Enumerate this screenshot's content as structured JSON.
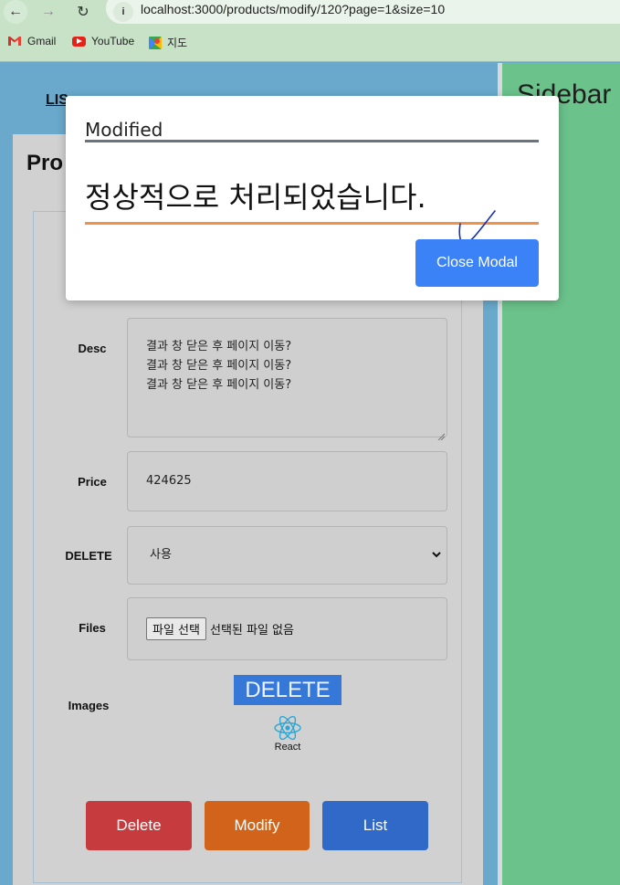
{
  "browser": {
    "url": "localhost:3000/products/modify/120?page=1&size=10",
    "bookmarks": [
      {
        "label": "Gmail",
        "icon": "gmail-icon"
      },
      {
        "label": "YouTube",
        "icon": "youtube-icon"
      },
      {
        "label": "지도",
        "icon": "maps-icon"
      }
    ]
  },
  "nav": {
    "list_link": "LIS"
  },
  "sidebar": {
    "title": "Sidebar"
  },
  "content": {
    "title": "Pro",
    "fields": {
      "desc": {
        "label": "Desc",
        "lines": [
          "결과 창 닫은 후 페이지 이동?",
          "결과 창 닫은 후 페이지 이동?",
          "결과 창 닫은 후 페이지 이동?"
        ]
      },
      "price": {
        "label": "Price",
        "value": "424625"
      },
      "delete": {
        "label": "DELETE",
        "selected": "사용"
      },
      "files": {
        "label": "Files",
        "button": "파일 선택",
        "status": "선택된 파일 없음"
      },
      "images": {
        "label": "Images",
        "delete_label": "DELETE",
        "image_caption": "React"
      }
    },
    "buttons": {
      "delete": "Delete",
      "modify": "Modify",
      "list": "List"
    }
  },
  "modal": {
    "title": "Modified",
    "message": "정상적으로 처리되었습니다.",
    "close_label": "Close Modal"
  },
  "colors": {
    "main_bg": "#6aa9cc",
    "sidebar_bg": "#6bc28b",
    "delete_btn": "#c63b3d",
    "modify_btn": "#d1641a",
    "list_btn": "#3069c8",
    "modal_close": "#3b82f6",
    "modal_accent": "#f0924a"
  }
}
